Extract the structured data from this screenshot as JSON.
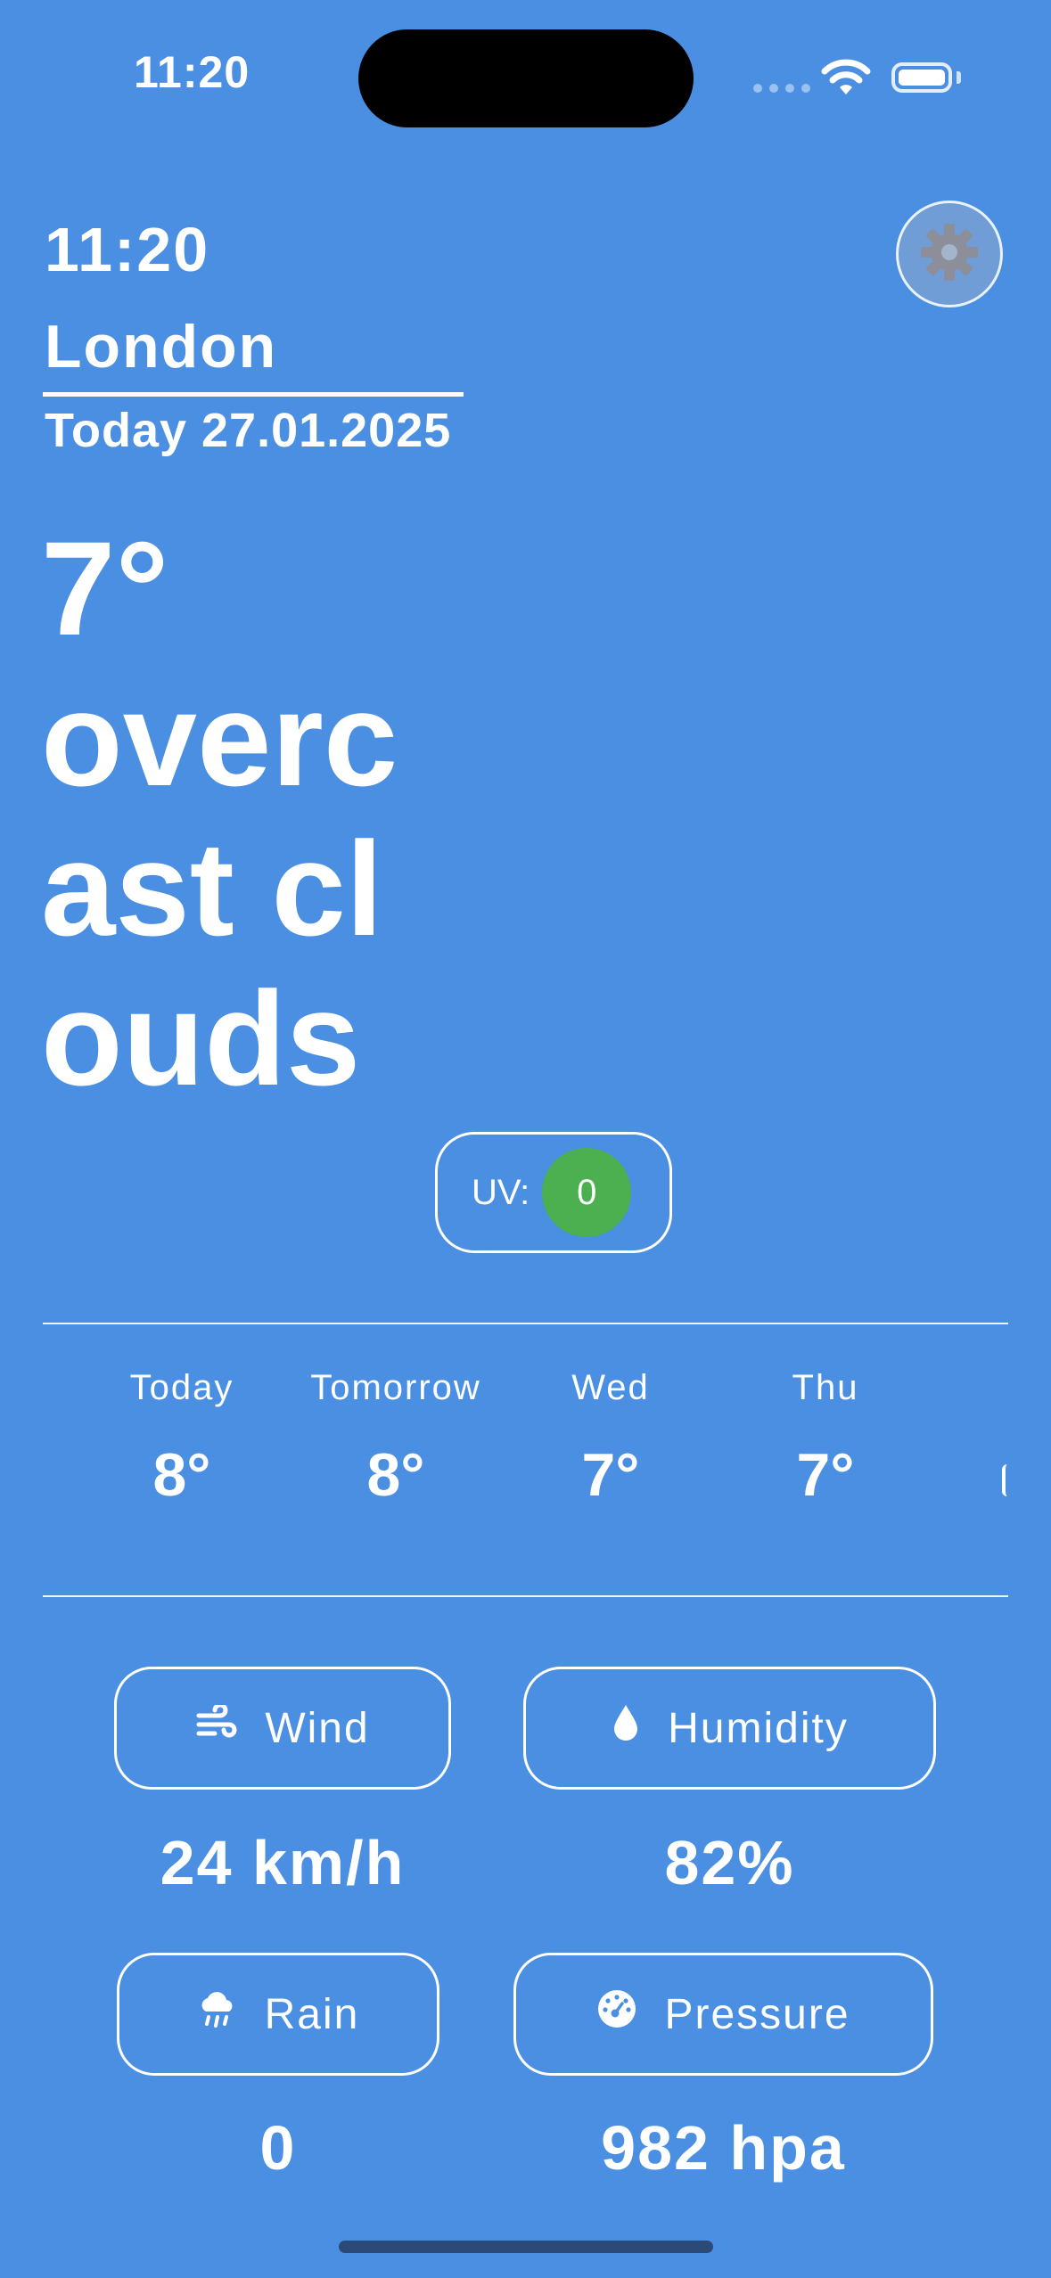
{
  "status_bar": {
    "time": "11:20"
  },
  "header": {
    "time": "11:20",
    "city": "London",
    "date": "Today 27.01.2025"
  },
  "current": {
    "temperature": "7°",
    "description": "overcast clouds",
    "uv_label": "UV:",
    "uv_value": "0",
    "uv_color": "#4caf50"
  },
  "forecast": [
    {
      "day": "Today",
      "temp": "8°"
    },
    {
      "day": "Tomorrow",
      "temp": "8°"
    },
    {
      "day": "Wed",
      "temp": "7°"
    },
    {
      "day": "Thu",
      "temp": "7°"
    }
  ],
  "details": {
    "wind": {
      "label": "Wind",
      "value": "24 km/h",
      "icon": "wind-icon"
    },
    "humidity": {
      "label": "Humidity",
      "value": "82%",
      "icon": "droplet-icon"
    },
    "rain": {
      "label": "Rain",
      "value": "0",
      "icon": "rain-cloud-icon"
    },
    "pressure": {
      "label": "Pressure",
      "value": "982 hpa",
      "icon": "gauge-icon"
    }
  },
  "colors": {
    "background": "#4a8fe2",
    "text": "#ffffff"
  }
}
